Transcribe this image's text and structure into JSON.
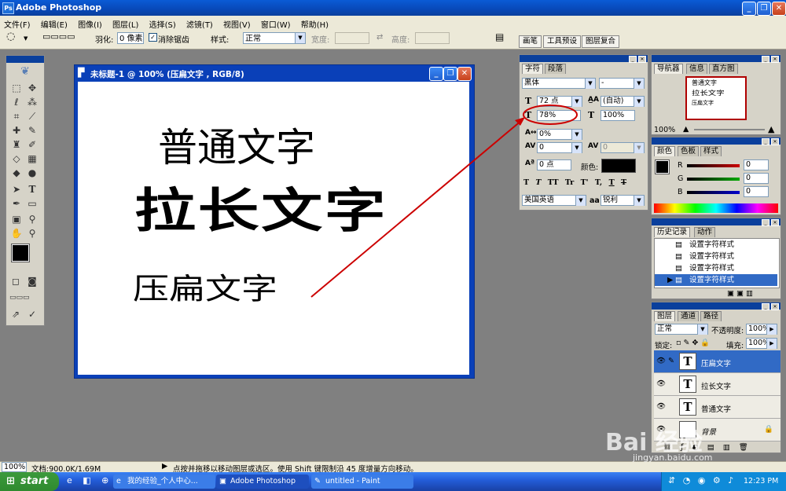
{
  "window": {
    "title": "Adobe Photoshop"
  },
  "menu": [
    "文件(F)",
    "编辑(E)",
    "图像(I)",
    "图层(L)",
    "选择(S)",
    "滤镜(T)",
    "视图(V)",
    "窗口(W)",
    "帮助(H)"
  ],
  "options": {
    "feather_label": "羽化:",
    "feather_value": "0 像素",
    "antialias_label": "消除锯齿",
    "style_label": "样式:",
    "style_value": "正常",
    "width_label": "宽度:",
    "height_label": "高度:",
    "tabs": [
      "画笔",
      "工具预设",
      "图层复合"
    ]
  },
  "document": {
    "title": "未标题-1 @ 100% (压扁文字 , RGB/8)",
    "texts": [
      "普通文字",
      "拉长文字",
      "压扁文字"
    ]
  },
  "character_panel": {
    "tabs": [
      "字符",
      "段落"
    ],
    "font_family": "黑体",
    "font_style": "-",
    "size": "72 点",
    "leading": "(自动)",
    "vertical_scale": "78%",
    "horizontal_scale": "100%",
    "tracking": "0%",
    "kerning": "0",
    "baseline": "0",
    "baseline_shift": "0 点",
    "color_label": "颜色:",
    "text_color": "#000000",
    "style_buttons": [
      "T",
      "T",
      "TT",
      "Tr",
      "T'",
      "T,",
      "T",
      "T"
    ],
    "language": "美国英语",
    "aa_label": "aa",
    "antialias": "锐利"
  },
  "navigator_panel": {
    "tabs": [
      "导航器",
      "信息",
      "直方图"
    ],
    "zoom": "100%",
    "thumb_texts": [
      "普通文字",
      "拉长文字",
      "压扁文字"
    ]
  },
  "color_panel": {
    "tabs": [
      "颜色",
      "色板",
      "样式"
    ],
    "channels": [
      {
        "label": "R",
        "value": "0",
        "color": "#cc0000"
      },
      {
        "label": "G",
        "value": "0",
        "color": "#00aa00"
      },
      {
        "label": "B",
        "value": "0",
        "color": "#0000cc"
      }
    ]
  },
  "history_panel": {
    "tabs": [
      "历史记录",
      "动作"
    ],
    "items": [
      "设置字符样式",
      "设置字符样式",
      "设置字符样式",
      "设置字符样式"
    ]
  },
  "layers_panel": {
    "tabs": [
      "图层",
      "通道",
      "路径"
    ],
    "blend_mode": "正常",
    "opacity_label": "不透明度:",
    "opacity": "100%",
    "lock_label": "锁定:",
    "fill_label": "填充:",
    "fill": "100%",
    "layers": [
      {
        "name": "压扁文字",
        "selected": true
      },
      {
        "name": "拉长文字",
        "selected": false
      },
      {
        "name": "普通文字",
        "selected": false
      },
      {
        "name": "背景",
        "selected": false
      }
    ]
  },
  "status": {
    "zoom": "100%",
    "doc_info": "文档:900.0K/1.69M",
    "hint": "点按并拖移以移动图层或选区。使用 Shift 键限制沿 45 度增量方向移动。"
  },
  "taskbar": {
    "start": "start",
    "tasks": [
      "我的经验_个人中心...",
      "Adobe Photoshop",
      "untitled - Paint"
    ],
    "lang": "CH",
    "clock": "12:23 PM"
  },
  "watermark": [
    "Bai 经验",
    "jingyan.baidu.com"
  ],
  "annotation_color": "#cc0000"
}
